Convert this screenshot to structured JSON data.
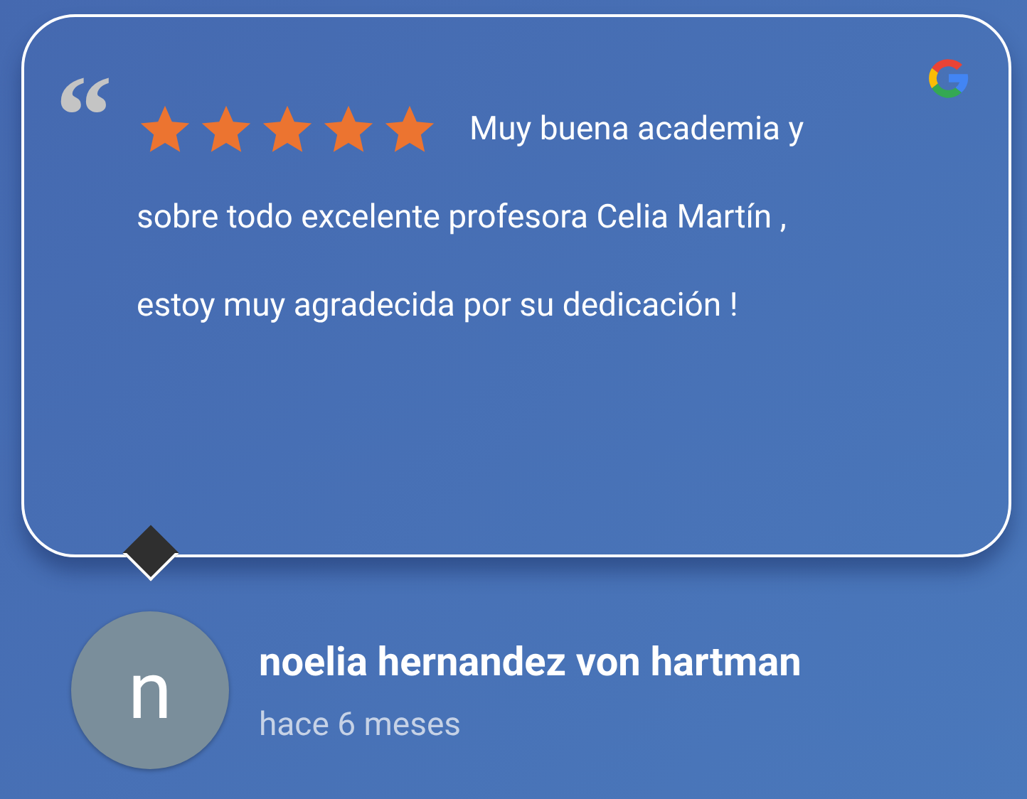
{
  "review": {
    "quote_mark": "“",
    "stars": 5,
    "lines": [
      "Muy buena academia y",
      "sobre todo excelente profesora Celia Martín ,",
      "estoy muy agradecida por su dedicación !"
    ]
  },
  "author": {
    "avatar_letter": "n",
    "name": "noelia hernandez von hartman",
    "time": "hace 6 meses"
  }
}
